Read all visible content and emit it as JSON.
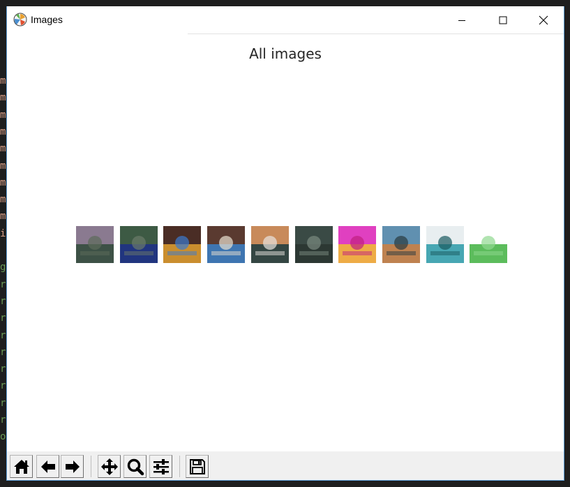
{
  "window": {
    "title": "Images",
    "controls": {
      "minimize": "minimize-icon",
      "maximize": "maximize-icon",
      "close": "close-icon"
    }
  },
  "background_terminal": {
    "lines": [
      {
        "text": "m",
        "color": "#d69d85"
      },
      {
        "text": "m",
        "color": "#d69d85"
      },
      {
        "text": "m",
        "color": "#d69d85"
      },
      {
        "text": "m",
        "color": "#d69d85"
      },
      {
        "text": "m",
        "color": "#d69d85"
      },
      {
        "text": "m",
        "color": "#d69d85"
      },
      {
        "text": "m",
        "color": "#d69d85"
      },
      {
        "text": "m",
        "color": "#d69d85"
      },
      {
        "text": "m",
        "color": "#d69d85"
      },
      {
        "text": "i",
        "color": "#d69d85"
      },
      {
        "text": "",
        "color": "#6a9955"
      },
      {
        "text": "g",
        "color": "#6a9955"
      },
      {
        "text": "r",
        "color": "#6a9955"
      },
      {
        "text": "r",
        "color": "#6a9955"
      },
      {
        "text": "r",
        "color": "#6a9955"
      },
      {
        "text": "r",
        "color": "#6a9955"
      },
      {
        "text": "r",
        "color": "#6a9955"
      },
      {
        "text": "r",
        "color": "#6a9955"
      },
      {
        "text": "r",
        "color": "#6a9955"
      },
      {
        "text": "r",
        "color": "#6a9955"
      },
      {
        "text": "r",
        "color": "#6a9955"
      },
      {
        "text": "o",
        "color": "#6a9955"
      }
    ]
  },
  "figure": {
    "title": "All images",
    "images": [
      {
        "name": "mountain-meadow-image",
        "colors": [
          "#8a7a90",
          "#2f4a3a",
          "#5d6b5a"
        ]
      },
      {
        "name": "jurassic-park-image",
        "colors": [
          "#3d5a44",
          "#1c2f8a",
          "#6b7a6a"
        ]
      },
      {
        "name": "logo-collection-image",
        "colors": [
          "#4a2d25",
          "#e0a030",
          "#3a7ad0"
        ]
      },
      {
        "name": "icon-collection-image",
        "colors": [
          "#5a3a30",
          "#3a80c8",
          "#e8e0d0"
        ]
      },
      {
        "name": "autumn-lake-image",
        "colors": [
          "#c88a5a",
          "#1a3a40",
          "#e8e4e0"
        ]
      },
      {
        "name": "dark-forest-image",
        "colors": [
          "#3a4a45",
          "#2a3530",
          "#7a8a80"
        ]
      },
      {
        "name": "keep-calm-image",
        "colors": [
          "#e040c0",
          "#f0c030",
          "#c02080"
        ]
      },
      {
        "name": "sunset-coast-image",
        "colors": [
          "#6090b0",
          "#d08040",
          "#2a3a40"
        ]
      },
      {
        "name": "turquoise-river-image",
        "colors": [
          "#e8eef0",
          "#2a9aa8",
          "#1a5a60"
        ]
      },
      {
        "name": "green-tree-image",
        "colors": [
          "#ffffff",
          "#40b040",
          "#90d890"
        ]
      }
    ]
  },
  "toolbar": {
    "buttons": [
      {
        "name": "home-button",
        "icon": "home-icon"
      },
      {
        "name": "back-button",
        "icon": "arrow-left-icon"
      },
      {
        "name": "forward-button",
        "icon": "arrow-right-icon"
      },
      {
        "name": "pan-button",
        "icon": "move-icon"
      },
      {
        "name": "zoom-button",
        "icon": "magnifier-icon"
      },
      {
        "name": "configure-subplots-button",
        "icon": "sliders-icon"
      },
      {
        "name": "save-button",
        "icon": "floppy-disk-icon"
      }
    ]
  }
}
